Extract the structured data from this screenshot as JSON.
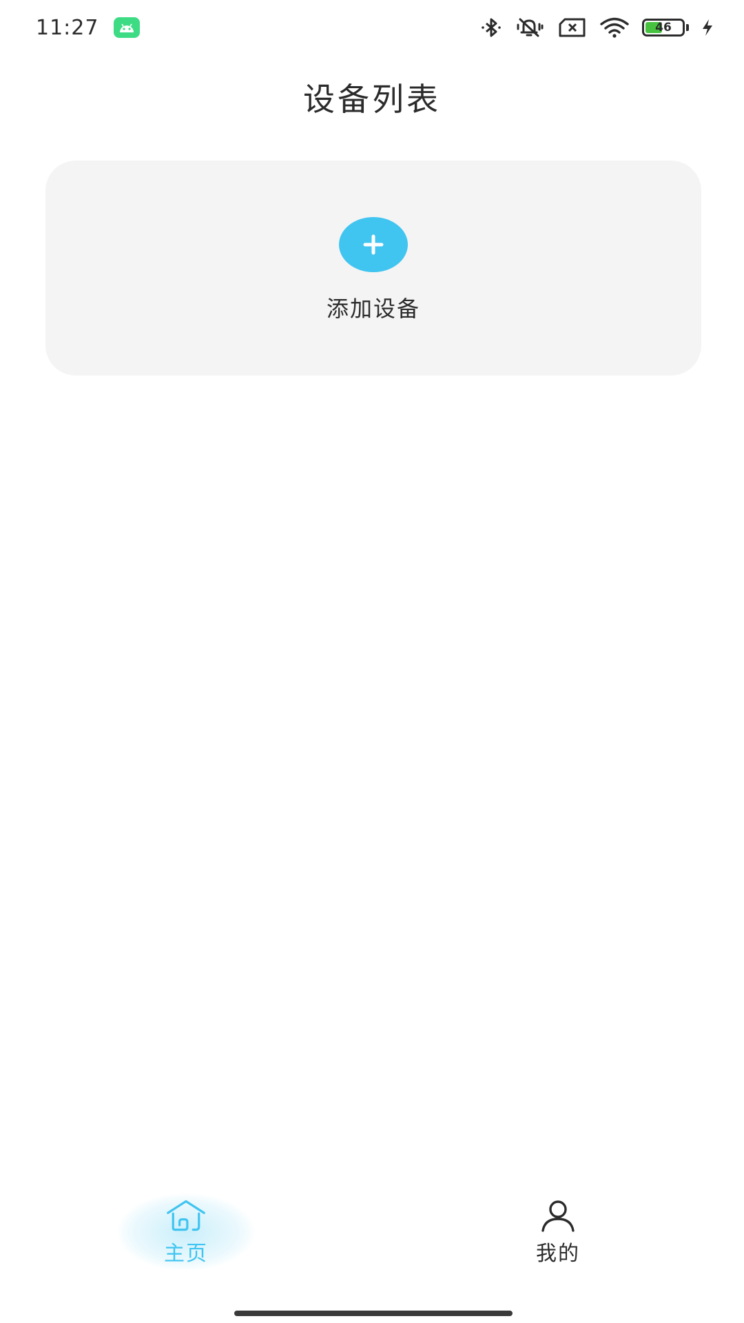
{
  "status_bar": {
    "time": "11:27",
    "battery_level": "46",
    "icons": [
      "android-icon",
      "bluetooth-icon",
      "mute-icon",
      "no-sim-icon",
      "wifi-icon",
      "battery-icon",
      "charging-icon"
    ]
  },
  "page": {
    "title": "设备列表"
  },
  "add_device": {
    "label": "添加设备",
    "button_symbol": "+"
  },
  "bottom_nav": {
    "items": [
      {
        "label": "主页",
        "icon": "home-icon",
        "active": true
      },
      {
        "label": "我的",
        "icon": "profile-icon",
        "active": false
      }
    ]
  },
  "colors": {
    "accent": "#40c4f0",
    "text": "#2b2b2b",
    "card_bg": "#f4f4f4",
    "battery_green": "#46c23f"
  }
}
